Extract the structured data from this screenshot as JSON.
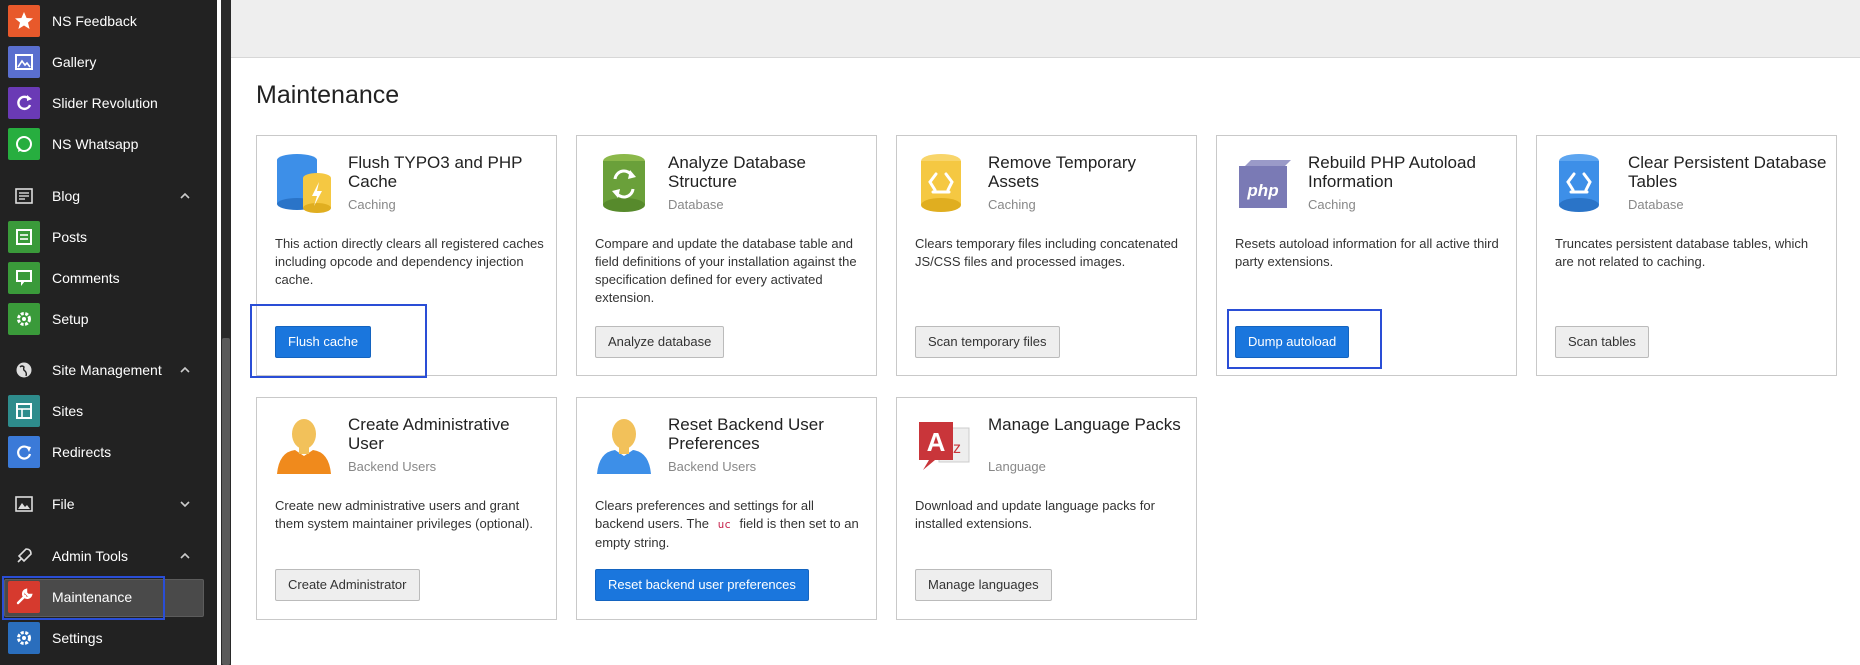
{
  "sidebar": {
    "items": [
      {
        "label": "NS Feedback",
        "icon": "star-icon",
        "color": "#e8592b"
      },
      {
        "label": "Gallery",
        "icon": "gallery-icon",
        "color": "#5a6fcf"
      },
      {
        "label": "Slider Revolution",
        "icon": "refresh-icon",
        "color": "#6a3ab5"
      },
      {
        "label": "NS Whatsapp",
        "icon": "whatsapp-icon",
        "color": "#27ae3f"
      }
    ],
    "blog": {
      "label": "Blog",
      "items": [
        {
          "label": "Posts",
          "icon": "posts-icon",
          "color": "#3a9a3a"
        },
        {
          "label": "Comments",
          "icon": "comments-icon",
          "color": "#3a9a3a"
        },
        {
          "label": "Setup",
          "icon": "setup-gear-icon",
          "color": "#3a9a3a"
        }
      ]
    },
    "site_management": {
      "label": "Site Management",
      "items": [
        {
          "label": "Sites",
          "icon": "sites-icon",
          "color": "#2e8c8c"
        },
        {
          "label": "Redirects",
          "icon": "redirects-icon",
          "color": "#3b7ad8"
        }
      ]
    },
    "file": {
      "label": "File"
    },
    "admin_tools": {
      "label": "Admin Tools",
      "items": [
        {
          "label": "Maintenance",
          "icon": "wrench-icon",
          "color": "#d63a2e"
        },
        {
          "label": "Settings",
          "icon": "gear-icon",
          "color": "#2a6ebd"
        }
      ]
    }
  },
  "main": {
    "title": "Maintenance",
    "cards": [
      {
        "title": "Flush TYPO3 and PHP Cache",
        "category": "Caching",
        "description": "This action directly clears all registered caches including opcode and dependency injection cache.",
        "button": "Flush cache",
        "icon": "cache-icon"
      },
      {
        "title": "Analyze Database Structure",
        "category": "Database",
        "description": "Compare and update the database table and field definitions of your installation against the specification defined for every activated extension.",
        "button": "Analyze database",
        "icon": "database-analyze-icon"
      },
      {
        "title": "Remove Temporary Assets",
        "category": "Caching",
        "description": "Clears temporary files including concatenated JS/CSS files and processed images.",
        "button": "Scan temporary files",
        "icon": "temp-assets-icon"
      },
      {
        "title": "Rebuild PHP Autoload Information",
        "category": "Caching",
        "description": "Resets autoload information for all active third party extensions.",
        "button": "Dump autoload",
        "icon": "php-icon"
      },
      {
        "title": "Clear Persistent Database Tables",
        "category": "Database",
        "description": "Truncates persistent database tables, which are not related to caching.",
        "button": "Scan tables",
        "icon": "database-recycle-icon"
      },
      {
        "title": "Create Administrative User",
        "category": "Backend Users",
        "description": "Create new administrative users and grant them system maintainer privileges (optional).",
        "button": "Create Administrator",
        "icon": "admin-user-icon"
      },
      {
        "title": "Reset Backend User Preferences",
        "category": "Backend Users",
        "description_before": "Clears preferences and settings for all backend users. The",
        "description_code": "uc",
        "description_after": "field is then set to an empty string.",
        "button": "Reset backend user preferences",
        "icon": "user-reset-icon"
      },
      {
        "title": "Manage Language Packs",
        "category": "Language",
        "description": "Download and update language packs for installed extensions.",
        "button": "Manage languages",
        "icon": "language-icon"
      }
    ]
  },
  "colors": {
    "primary": "#1a76dd",
    "highlight": "#2a4ed6",
    "sidebar_bg": "#222222"
  }
}
